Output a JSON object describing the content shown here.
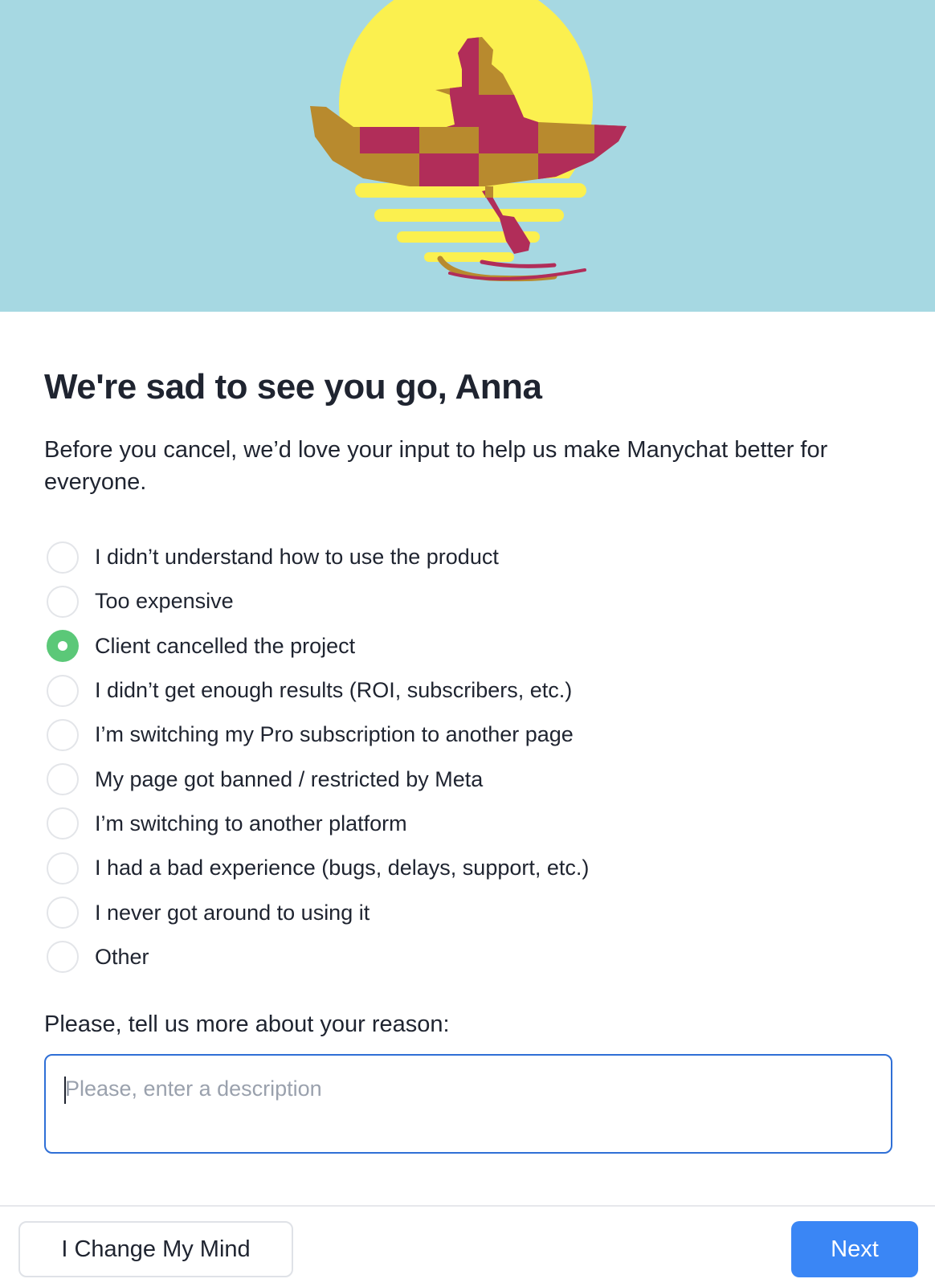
{
  "header": {
    "illustration_name": "sunset-boat-illustration",
    "colors": {
      "sky": "#a6d8e2",
      "sun": "#fbf04f",
      "boat_gold": "#b88a2e",
      "boat_magenta": "#b12d59"
    }
  },
  "main": {
    "title": "We're sad to see you go, Anna",
    "subtitle": "Before you cancel, we’d love your input to help us make Manychat better for everyone."
  },
  "reasons": [
    {
      "label": "I didn’t understand how to use the product",
      "checked": false
    },
    {
      "label": "Too expensive",
      "checked": false
    },
    {
      "label": "Client cancelled the project",
      "checked": true
    },
    {
      "label": "I didn’t get enough results (ROI, subscribers, etc.)",
      "checked": false
    },
    {
      "label": "I’m switching my Pro subscription to another page",
      "checked": false
    },
    {
      "label": "My page got banned / restricted by Meta",
      "checked": false
    },
    {
      "label": "I’m switching to another platform",
      "checked": false
    },
    {
      "label": "I had a bad experience (bugs, delays, support, etc.)",
      "checked": false
    },
    {
      "label": "I never got around to using it",
      "checked": false
    },
    {
      "label": "Other",
      "checked": false
    }
  ],
  "details": {
    "label": "Please, tell us more about your reason:",
    "placeholder": "Please, enter a description",
    "value": ""
  },
  "footer": {
    "secondary_label": "I Change My Mind",
    "primary_label": "Next",
    "colors": {
      "primary": "#3a86f5",
      "selected_radio": "#5bc878"
    }
  }
}
